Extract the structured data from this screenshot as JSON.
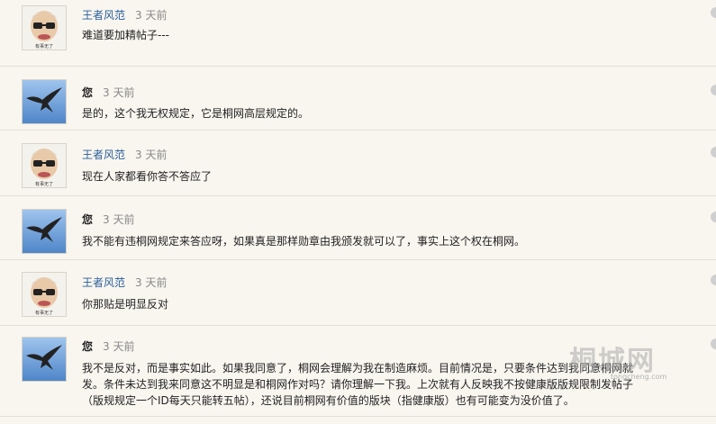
{
  "messages": [
    {
      "user": "王者风范",
      "time": "3 天前",
      "text": "难道要加精帖子---",
      "avatar": "cartoon-face"
    },
    {
      "user": "您",
      "time": "3 天前",
      "text": "是的，这个我无权规定，它是桐网高层规定的。",
      "avatar": "eagle"
    },
    {
      "user": "王者风范",
      "time": "3 天前",
      "text": "现在人家都看你答不答应了",
      "avatar": "cartoon-face"
    },
    {
      "user": "您",
      "time": "3 天前",
      "text": "我不能有违桐网规定来答应呀，如果真是那样勋章由我颁发就可以了，事实上这个权在桐网。",
      "avatar": "eagle"
    },
    {
      "user": "王者风范",
      "time": "3 天前",
      "text": "你那贴是明显反对",
      "avatar": "cartoon-face"
    },
    {
      "user": "您",
      "time": "3 天前",
      "text_lines": [
        "我不是反对，而是事实如此。如果我同意了，桐网会理解为我在制造麻烦。目前情况是，只要条件达到我同意桐网就",
        "发。条件未达到我来同意这不明显是和桐网作对吗？请你理解一下我。上次就有人反映我不按健康版版规限制发帖子",
        "（版规规定一个ID每天只能转五帖），还说目前桐网有价值的版块（指健康版）也有可能变为没价值了。"
      ],
      "avatar": "eagle"
    }
  ],
  "watermark": {
    "text": "桐城网",
    "sub": "tongcheng.com"
  }
}
